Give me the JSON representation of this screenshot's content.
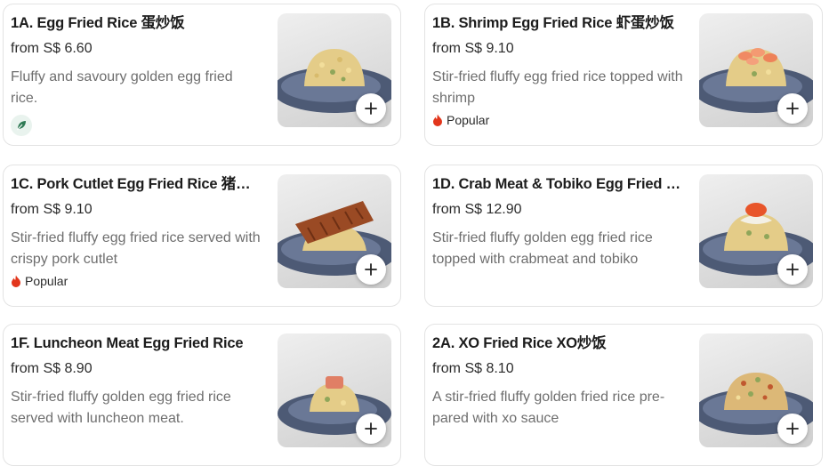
{
  "menu": {
    "items": [
      {
        "title": "1A. Egg Fried Rice 蛋炒饭",
        "price": "from S$ 6.60",
        "description": "Fluffy and savoury golden egg fried rice.",
        "badge": "leaf",
        "badge_label": "",
        "image": "egg-fried-rice-photo"
      },
      {
        "title": "1B. Shrimp Egg Fried Rice 虾蛋炒饭",
        "price": "from S$ 9.10",
        "description": "Stir-fried fluffy egg fried rice topped with shrimp",
        "badge": "popular",
        "badge_label": "Popular",
        "image": "shrimp-fried-rice-photo"
      },
      {
        "title": "1C. Pork Cutlet Egg Fried Rice 猪扒…",
        "price": "from S$ 9.10",
        "description": "Stir-fried fluffy egg fried rice served with crispy pork cutlet",
        "badge": "popular",
        "badge_label": "Popular",
        "image": "pork-cutlet-fried-rice-photo"
      },
      {
        "title": "1D. Crab Meat & Tobiko Egg Fried R…",
        "price": "from S$ 12.90",
        "description": "Stir-fried fluffy golden egg fried rice topped with crabmeat and tobiko",
        "badge": "none",
        "badge_label": "",
        "image": "crab-tobiko-fried-rice-photo"
      },
      {
        "title": "1F. Luncheon Meat Egg Fried Rice",
        "price": "from S$ 8.90",
        "description": "Stir-fried fluffy golden egg fried rice served with luncheon meat.",
        "badge": "none",
        "badge_label": "",
        "image": "luncheon-meat-fried-rice-photo"
      },
      {
        "title": "2A. XO Fried Rice XO炒饭",
        "price": "from S$ 8.10",
        "description": "A stir-fried fluffy golden fried rice pre-pared with xo sauce",
        "badge": "none",
        "badge_label": "",
        "image": "xo-fried-rice-photo"
      }
    ]
  },
  "colors": {
    "popular_flame": "#e2361c",
    "leaf_icon": "#2f7a55",
    "leaf_bg": "#e9f3ee",
    "text_primary": "#1c1c1c",
    "text_secondary": "#6e6e6e"
  },
  "icons": {
    "add": "plus-icon",
    "popular": "flame-icon",
    "vegetarian": "leaf-icon"
  }
}
